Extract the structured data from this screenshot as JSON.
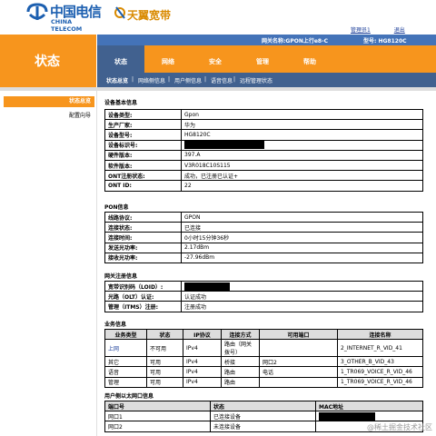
{
  "header": {
    "logo_ct_cn": "中国电信",
    "logo_ct_en": "CHINA TELECOM",
    "logo_ty_cn": "天翼宽带",
    "links": [
      "管理员1",
      "退出"
    ],
    "device_name": "网关名称:GPON上行e8-C",
    "model": "型号: HG8120C"
  },
  "status_panel_title": "状态",
  "nav": {
    "tabs": [
      "状态",
      "网络",
      "安全",
      "管理",
      "帮助"
    ],
    "active_tab": 0,
    "subtabs": [
      "状态总览",
      "网络侧信息",
      "用户侧信息",
      "语音信息",
      "远程管理状态"
    ],
    "active_subtab": 0
  },
  "sidebar": {
    "items": [
      "状态总览",
      "配置向导"
    ],
    "active": 0
  },
  "device_info": {
    "title": "设备基本信息",
    "rows": [
      [
        "设备类型:",
        "Gpon"
      ],
      [
        "生产厂家:",
        "华为"
      ],
      [
        "设备型号:",
        "HG8120C"
      ],
      [
        "设备标识号:",
        ""
      ],
      [
        "硬件版本:",
        "397.A"
      ],
      [
        "软件版本:",
        "V3R018C10S115"
      ],
      [
        "ONT注册状态:",
        "成功，已注册已认证+"
      ],
      [
        "ONT ID:",
        "22"
      ]
    ]
  },
  "pon_info": {
    "title": "PON信息",
    "rows": [
      [
        "线路协议:",
        "GPON"
      ],
      [
        "连接状态:",
        "已连接"
      ],
      [
        "连接时间:",
        "0小时15分钟36秒"
      ],
      [
        "发送光功率:",
        "2.17dBm"
      ],
      [
        "接收光功率:",
        "-27.96dBm"
      ]
    ]
  },
  "registration": {
    "title": "网关注册信息",
    "rows": [
      [
        "宽带识别码（LOID）:",
        ""
      ],
      [
        "光路（OLT）认证:",
        "认证成功"
      ],
      [
        "管理（ITMS）注册:",
        "注册成功"
      ]
    ]
  },
  "services": {
    "title": "业务信息",
    "headers": [
      "业务类型",
      "状态",
      "IP协议",
      "连接方式",
      "可用端口",
      "连接名称"
    ],
    "rows": [
      [
        "上网",
        "不可用",
        "IPv4",
        "路由（网关拨号）",
        "",
        "2_INTERNET_R_VID_41"
      ],
      [
        "其它",
        "可用",
        "IPv4",
        "桥接",
        "网口2",
        "3_OTHER_B_VID_43"
      ],
      [
        "语音",
        "可用",
        "IPv4",
        "路由",
        "电话",
        "1_TR069_VOICE_R_VID_46"
      ],
      [
        "管理",
        "可用",
        "IPv4",
        "路由",
        "",
        "1_TR069_VOICE_R_VID_46"
      ]
    ]
  },
  "ports": {
    "title": "用户侧以太网口信息",
    "headers": [
      "端口号",
      "状态",
      "MAC地址"
    ],
    "rows": [
      [
        "网口1",
        "已连接设备",
        ""
      ],
      [
        "网口2",
        "未连接设备",
        ""
      ]
    ]
  },
  "watermark": "@稀土掘金技术社区",
  "colors": {
    "orange": "#f7951d",
    "nav_blue": "#41618f",
    "strip_blue": "#4473b8",
    "brand_blue": "#1c5fb0",
    "tianyi_orange": "#d98a00"
  }
}
